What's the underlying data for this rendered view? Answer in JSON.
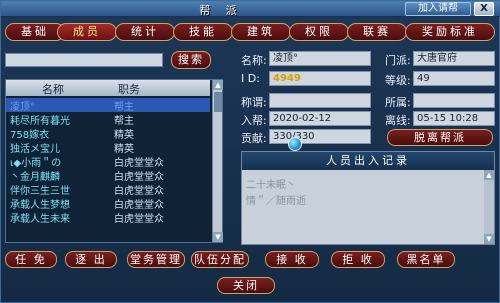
{
  "window": {
    "title": "帮 派",
    "join_label": "加入请帮",
    "close_label": "X"
  },
  "tabs": [
    {
      "label": "基础"
    },
    {
      "label": "成员",
      "active": true
    },
    {
      "label": "统计"
    },
    {
      "label": "技能"
    },
    {
      "label": "建筑"
    },
    {
      "label": "权限"
    },
    {
      "label": "联赛"
    },
    {
      "label": "奖励标准"
    }
  ],
  "search": {
    "value": "",
    "button_label": "搜索"
  },
  "member_list": {
    "headers": [
      "名称",
      "职务"
    ],
    "rows": [
      {
        "name": "凌顶°",
        "role": "帮主",
        "selected": true
      },
      {
        "name": "耗尽所有暮光",
        "role": "帮主"
      },
      {
        "name": "758嫁衣",
        "role": "精英"
      },
      {
        "name": "独活メ宝儿",
        "role": "精英"
      },
      {
        "name": "ι◆小雨＂の",
        "role": "白虎堂堂众"
      },
      {
        "name": "丶金月麒麟",
        "role": "白虎堂堂众"
      },
      {
        "name": "伴你三生三世",
        "role": "白虎堂堂众"
      },
      {
        "name": "承载人生梦想",
        "role": "白虎堂堂众"
      },
      {
        "name": "承载人生未来",
        "role": "白虎堂堂众"
      }
    ]
  },
  "member_info": {
    "name_label": "名称:",
    "name_value": "凌顶°",
    "id_label": "I  D:",
    "id_value": "4949",
    "title_label": "称谓:",
    "title_value": "",
    "join_label": "入帮:",
    "join_value": "2020-02-12",
    "contrib_label": "贡献:",
    "contrib_value": "330/330",
    "sect_label": "门派:",
    "sect_value": "大唐官府",
    "level_label": "等级:",
    "level_value": "49",
    "owner_label": "所属:",
    "owner_value": "",
    "offline_label": "离线:",
    "offline_value": "05-15 10:28",
    "leave_button": "脱离帮派"
  },
  "log": {
    "title": "人员出入记录",
    "lines": [
      "二十未眠丶",
      "情＂／随雨逝"
    ]
  },
  "actions": {
    "kick": "任 免",
    "expel": "逐 出",
    "affairs": "堂务管理",
    "team": "队伍分配",
    "accept": "接 收",
    "reject": "拒 收",
    "blacklist": "黑名单",
    "close": "关闭"
  }
}
